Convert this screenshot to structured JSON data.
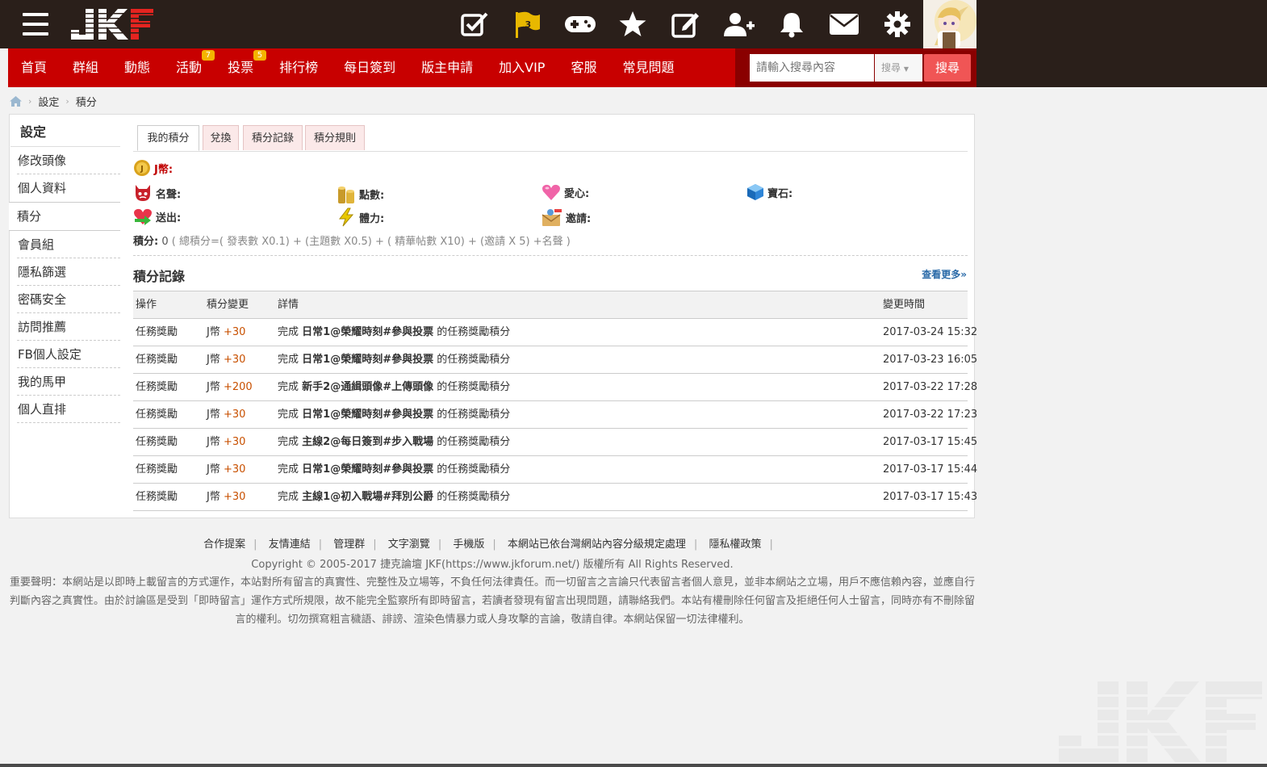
{
  "brand": {
    "logo_text": "JKF"
  },
  "header": {
    "flag_count": "3",
    "icons": [
      "checkbox-icon",
      "flag-icon",
      "gamepad-icon",
      "star-icon",
      "edit-icon",
      "add-friend-icon",
      "bell-icon",
      "mail-icon",
      "gear-icon"
    ]
  },
  "nav": {
    "items": [
      {
        "label": "首頁"
      },
      {
        "label": "群組"
      },
      {
        "label": "動態"
      },
      {
        "label": "活動",
        "badge": "7"
      },
      {
        "label": "投票",
        "badge": "5"
      },
      {
        "label": "排行榜"
      },
      {
        "label": "每日簽到"
      },
      {
        "label": "版主申請"
      },
      {
        "label": "加入VIP"
      },
      {
        "label": "客服"
      },
      {
        "label": "常見問題"
      }
    ],
    "search_placeholder": "請輸入搜尋內容",
    "search_select": "搜尋",
    "search_button": "搜尋"
  },
  "breadcrumb": {
    "items": [
      "設定",
      "積分"
    ]
  },
  "sidebar": {
    "title": "設定",
    "items": [
      "修改頭像",
      "個人資料",
      "積分",
      "會員組",
      "隱私篩選",
      "密碼安全",
      "訪問推薦",
      "FB個人設定",
      "我的馬甲",
      "個人直排"
    ],
    "active": "積分"
  },
  "tabs": [
    "我的積分",
    "兌換",
    "積分記錄",
    "積分規則"
  ],
  "credits": {
    "jcoin": "J幣:",
    "reputation": "名聲:",
    "points": "點數:",
    "love": "愛心:",
    "gem": "寶石:",
    "sent": "送出:",
    "stamina": "體力:",
    "invite": "邀請:"
  },
  "summary": {
    "label": "積分:",
    "value": "0",
    "formula": "( 總積分=( 發表數 X0.1) + (主題數 X0.5) + ( 精華帖數 X10) + (邀請 X 5) +名聲 )"
  },
  "records": {
    "title": "積分記錄",
    "more": "查看更多»",
    "headers": [
      "操作",
      "積分變更",
      "詳情",
      "變更時間"
    ],
    "rows": [
      {
        "action": "任務獎勵",
        "currency": "J幣",
        "change": "+30",
        "prefix": "完成",
        "task": "日常1@榮耀時刻#參與投票",
        "suffix": "的任務獎勵積分",
        "time": "2017-03-24 15:32"
      },
      {
        "action": "任務獎勵",
        "currency": "J幣",
        "change": "+30",
        "prefix": "完成",
        "task": "日常1@榮耀時刻#參與投票",
        "suffix": "的任務獎勵積分",
        "time": "2017-03-23 16:05"
      },
      {
        "action": "任務獎勵",
        "currency": "J幣",
        "change": "+200",
        "prefix": "完成",
        "task": "新手2@通緝頭像#上傳頭像",
        "suffix": "的任務獎勵積分",
        "time": "2017-03-22 17:28"
      },
      {
        "action": "任務獎勵",
        "currency": "J幣",
        "change": "+30",
        "prefix": "完成",
        "task": "日常1@榮耀時刻#參與投票",
        "suffix": "的任務獎勵積分",
        "time": "2017-03-22 17:23"
      },
      {
        "action": "任務獎勵",
        "currency": "J幣",
        "change": "+30",
        "prefix": "完成",
        "task": "主線2@每日簽到#步入戰場",
        "suffix": "的任務獎勵積分",
        "time": "2017-03-17 15:45"
      },
      {
        "action": "任務獎勵",
        "currency": "J幣",
        "change": "+30",
        "prefix": "完成",
        "task": "日常1@榮耀時刻#參與投票",
        "suffix": "的任務獎勵積分",
        "time": "2017-03-17 15:44"
      },
      {
        "action": "任務獎勵",
        "currency": "J幣",
        "change": "+30",
        "prefix": "完成",
        "task": "主線1@初入戰場#拜別公爵",
        "suffix": "的任務獎勵積分",
        "time": "2017-03-17 15:43"
      }
    ]
  },
  "footer": {
    "links": [
      "合作提案",
      "友情連結",
      "管理群",
      "文字瀏覽",
      "手機版",
      "本網站已依台灣網站內容分級規定處理",
      "隱私權政策"
    ],
    "copyright": "Copyright © 2005-2017 捷克論壇 JKF(https://www.jkforum.net/) 版權所有 All Rights Reserved.",
    "disclaimer": "重要聲明：本網站是以即時上載留言的方式運作，本站對所有留言的真實性、完整性及立場等，不負任何法律責任。而一切留言之言論只代表留言者個人意見，並非本網站之立場，用戶不應信賴內容，並應自行判斷內容之真實性。由於討論區是受到「即時留言」運作方式所規限，故不能完全監察所有即時留言，若讀者發現有留言出現問題，請聯絡我們。本站有權刪除任何留言及拒絕任何人士留言，同時亦有不刪除留言的權利。切勿撰寫粗言穢語、誹謗、渲染色情暴力或人身攻擊的言論，敬請自律。本網站保留一切法律權利。"
  },
  "colors": {
    "header_bg": "#2a1f1a",
    "nav_red": "#c80000",
    "nav_dark": "#8a0000",
    "search_btn": "#f05555",
    "points": "#c85000",
    "badge": "#f4b400"
  }
}
